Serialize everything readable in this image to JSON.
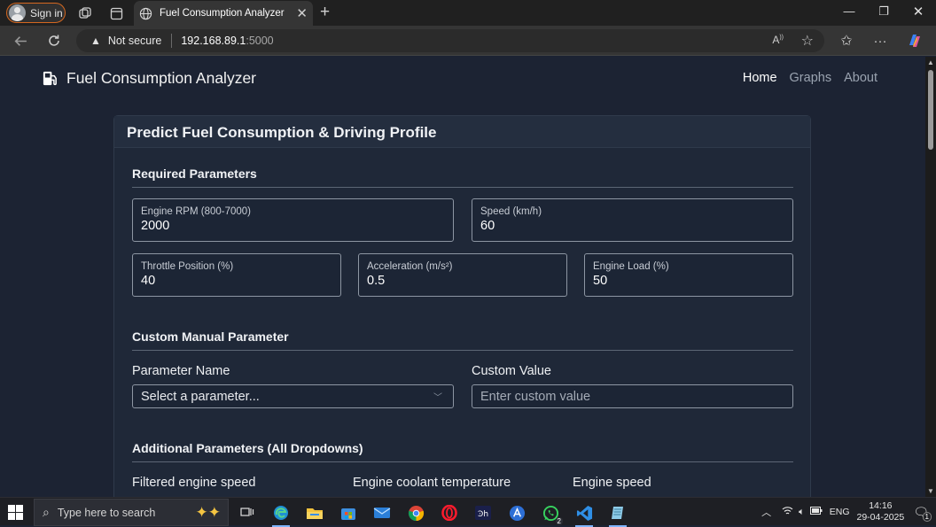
{
  "browser": {
    "sign_in_label": "Sign in",
    "tab_title": "Fuel Consumption Analyzer",
    "security_label": "Not secure",
    "url_host": "192.168.89.1",
    "url_port": ":5000"
  },
  "navbar": {
    "brand": "Fuel Consumption Analyzer",
    "links": [
      "Home",
      "Graphs",
      "About"
    ],
    "active_link": "Home"
  },
  "card": {
    "title": "Predict Fuel Consumption & Driving Profile",
    "required_section": "Required Parameters",
    "fields": [
      {
        "label": "Engine RPM (800-7000)",
        "value": "2000"
      },
      {
        "label": "Speed (km/h)",
        "value": "60"
      },
      {
        "label": "Throttle Position (%)",
        "value": "40"
      },
      {
        "label": "Acceleration (m/s²)",
        "value": "0.5"
      },
      {
        "label": "Engine Load (%)",
        "value": "50"
      }
    ],
    "custom_section": "Custom Manual Parameter",
    "param_name_label": "Parameter Name",
    "param_select_placeholder": "Select a parameter...",
    "custom_value_label": "Custom Value",
    "custom_value_placeholder": "Enter custom value",
    "additional_section": "Additional Parameters (All Dropdowns)",
    "additional_labels": [
      "Filtered engine speed",
      "Engine coolant temperature",
      "Engine speed"
    ]
  },
  "taskbar": {
    "search_placeholder": "Type here to search",
    "lang": "ENG",
    "time": "14:16",
    "date": "29-04-2025",
    "whatsapp_badge": "2",
    "notification_count": "1"
  },
  "colors": {
    "page_bg": "#1c2333",
    "card_bg": "#1f2838",
    "signin_border": "#d4671f",
    "taskbar_active": "#7fb4ff"
  }
}
